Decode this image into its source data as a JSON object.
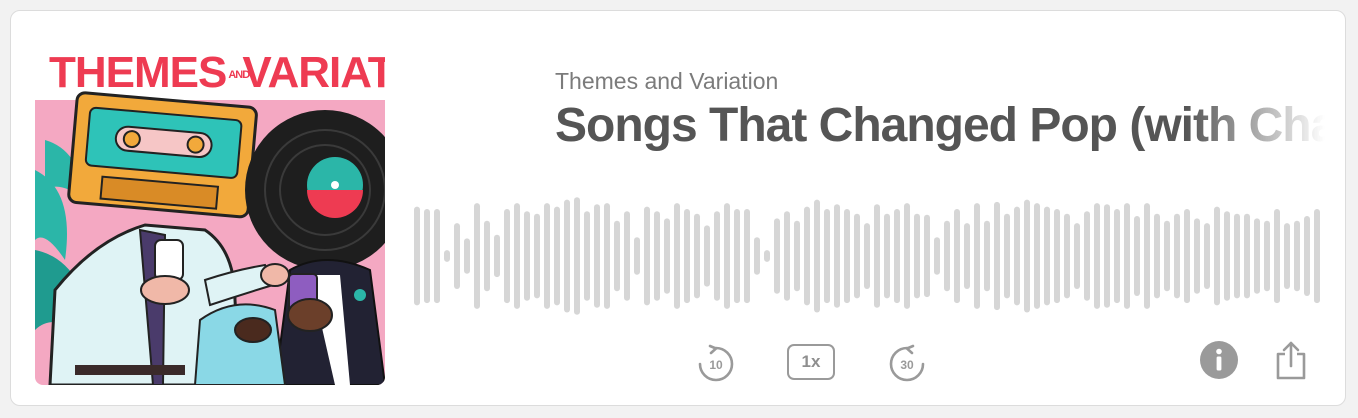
{
  "artwork": {
    "title_left": "THEMES",
    "title_and": "AND",
    "title_right": "VARIATION"
  },
  "podcast_name": "Themes and Variation",
  "episode_title": "Songs That Changed Pop (with Charlie Harding)",
  "controls": {
    "skip_back_label": "10",
    "speed_label": "1x",
    "skip_forward_label": "30"
  },
  "colors": {
    "title": "#555555",
    "subtitle": "#7b7b7b",
    "waveform": "#d6d6d6",
    "controls": "#9a9a9a",
    "art_red": "#ee3b52",
    "art_pink": "#f4a8c2",
    "art_teal": "#2bb6a8"
  },
  "waveform_levels": [
    0.42,
    0.4,
    0.4,
    0.05,
    0.28,
    0.15,
    0.45,
    0.3,
    0.18,
    0.4,
    0.45,
    0.38,
    0.36,
    0.45,
    0.42,
    0.48,
    0.5,
    0.38,
    0.44,
    0.45,
    0.3,
    0.38,
    0.16,
    0.42,
    0.38,
    0.32,
    0.45,
    0.4,
    0.36,
    0.26,
    0.38,
    0.45,
    0.4,
    0.4,
    0.16,
    0.05,
    0.32,
    0.38,
    0.3,
    0.42,
    0.48,
    0.4,
    0.44,
    0.4,
    0.36,
    0.28,
    0.44,
    0.36,
    0.4,
    0.45,
    0.36,
    0.35,
    0.16,
    0.3,
    0.4,
    0.28,
    0.45,
    0.3,
    0.46,
    0.36,
    0.42,
    0.48,
    0.45,
    0.42,
    0.4,
    0.36,
    0.28,
    0.38,
    0.45,
    0.44,
    0.4,
    0.45,
    0.34,
    0.45,
    0.36,
    0.3,
    0.36,
    0.4,
    0.32,
    0.28,
    0.42,
    0.38,
    0.36,
    0.36,
    0.32,
    0.3,
    0.4,
    0.28,
    0.3,
    0.34,
    0.4
  ]
}
